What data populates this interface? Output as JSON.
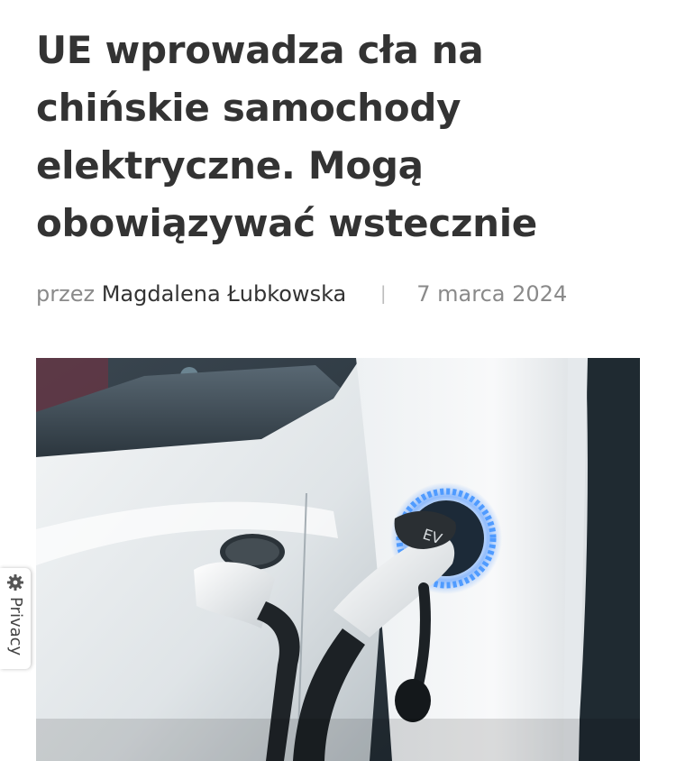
{
  "article": {
    "title": "UE wprowadza cła na chińskie samochody elektryczne. Mogą obowiązywać wstecznie",
    "byline_prefix": "przez",
    "author": "Magdalena Łubkowska",
    "separator": "|",
    "date": "7 marca 2024"
  },
  "hero_image": {
    "plug_label": "EV",
    "subject": "white electric car being charged at a charging station with blue glowing port"
  },
  "privacy": {
    "label": "Privacy",
    "icon": "gear-icon"
  },
  "colors": {
    "title_text": "#333333",
    "meta_text": "#8a8a8a",
    "charging_glow": "#2f7dff"
  }
}
